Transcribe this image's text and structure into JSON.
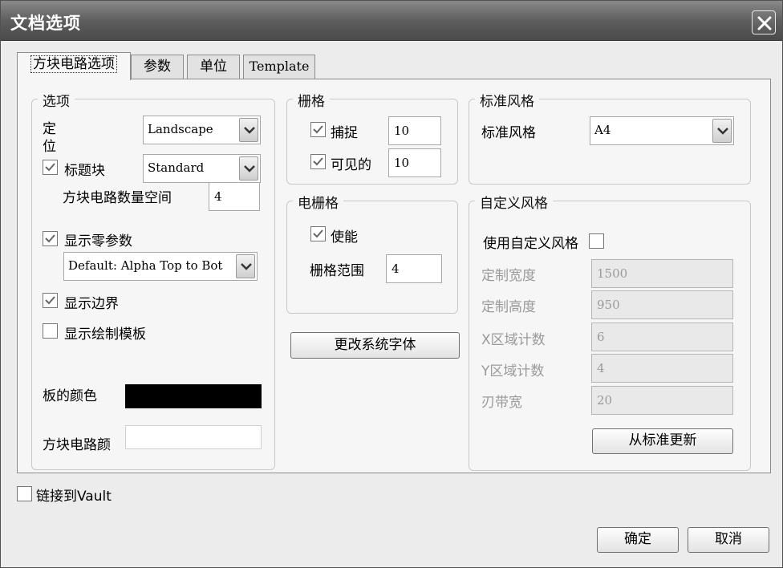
{
  "window": {
    "title": "文档选项"
  },
  "tabs": [
    {
      "label": "方块电路选项",
      "active": true
    },
    {
      "label": "参数",
      "active": false
    },
    {
      "label": "单位",
      "active": false
    },
    {
      "label": "Template",
      "active": false
    }
  ],
  "options": {
    "legend": "选项",
    "orientation_label": "定位",
    "orientation_value": "Landscape",
    "title_block_label": "标题块",
    "title_block_checked": true,
    "title_block_value": "Standard",
    "sheet_number_space_label": "方块电路数量空间",
    "sheet_number_space_value": "4",
    "show_reference_zones_label": "显示零参数",
    "show_reference_zones_checked": true,
    "zone_style_value": "Default: Alpha Top to Bot",
    "show_border_label": "显示边界",
    "show_border_checked": true,
    "show_template_graphics_label": "显示绘制模板",
    "show_template_graphics_checked": false,
    "border_color_label": "板的颜色",
    "border_color": "#000000",
    "sheet_color_label": "方块电路颜",
    "sheet_color": "#ffffff"
  },
  "grids": {
    "legend": "栅格",
    "snap_label": "捕捉",
    "snap_checked": true,
    "snap_value": "10",
    "visible_label": "可见的",
    "visible_checked": true,
    "visible_value": "10"
  },
  "electrical_grid": {
    "legend": "电栅格",
    "enable_label": "使能",
    "enable_checked": true,
    "range_label": "栅格范围",
    "range_value": "4"
  },
  "change_font_button": "更改系统字体",
  "standard_style": {
    "legend": "标准风格",
    "label": "标准风格",
    "value": "A4"
  },
  "custom_style": {
    "legend": "自定义风格",
    "use_custom_label": "使用自定义风格",
    "use_custom_checked": false,
    "custom_width_label": "定制宽度",
    "custom_width_value": "1500",
    "custom_height_label": "定制高度",
    "custom_height_value": "950",
    "x_region_count_label": "X区域计数",
    "x_region_count_value": "6",
    "y_region_count_label": "Y区域计数",
    "y_region_count_value": "4",
    "margin_width_label": "刃带宽",
    "margin_width_value": "20",
    "update_from_standard_button": "从标准更新"
  },
  "link_to_vault_label": "链接到Vault",
  "link_to_vault_checked": false,
  "ok_button": "确定",
  "cancel_button": "取消",
  "icons": [
    "close-icon",
    "checkmark-icon",
    "dropdown-arrow-icon"
  ]
}
